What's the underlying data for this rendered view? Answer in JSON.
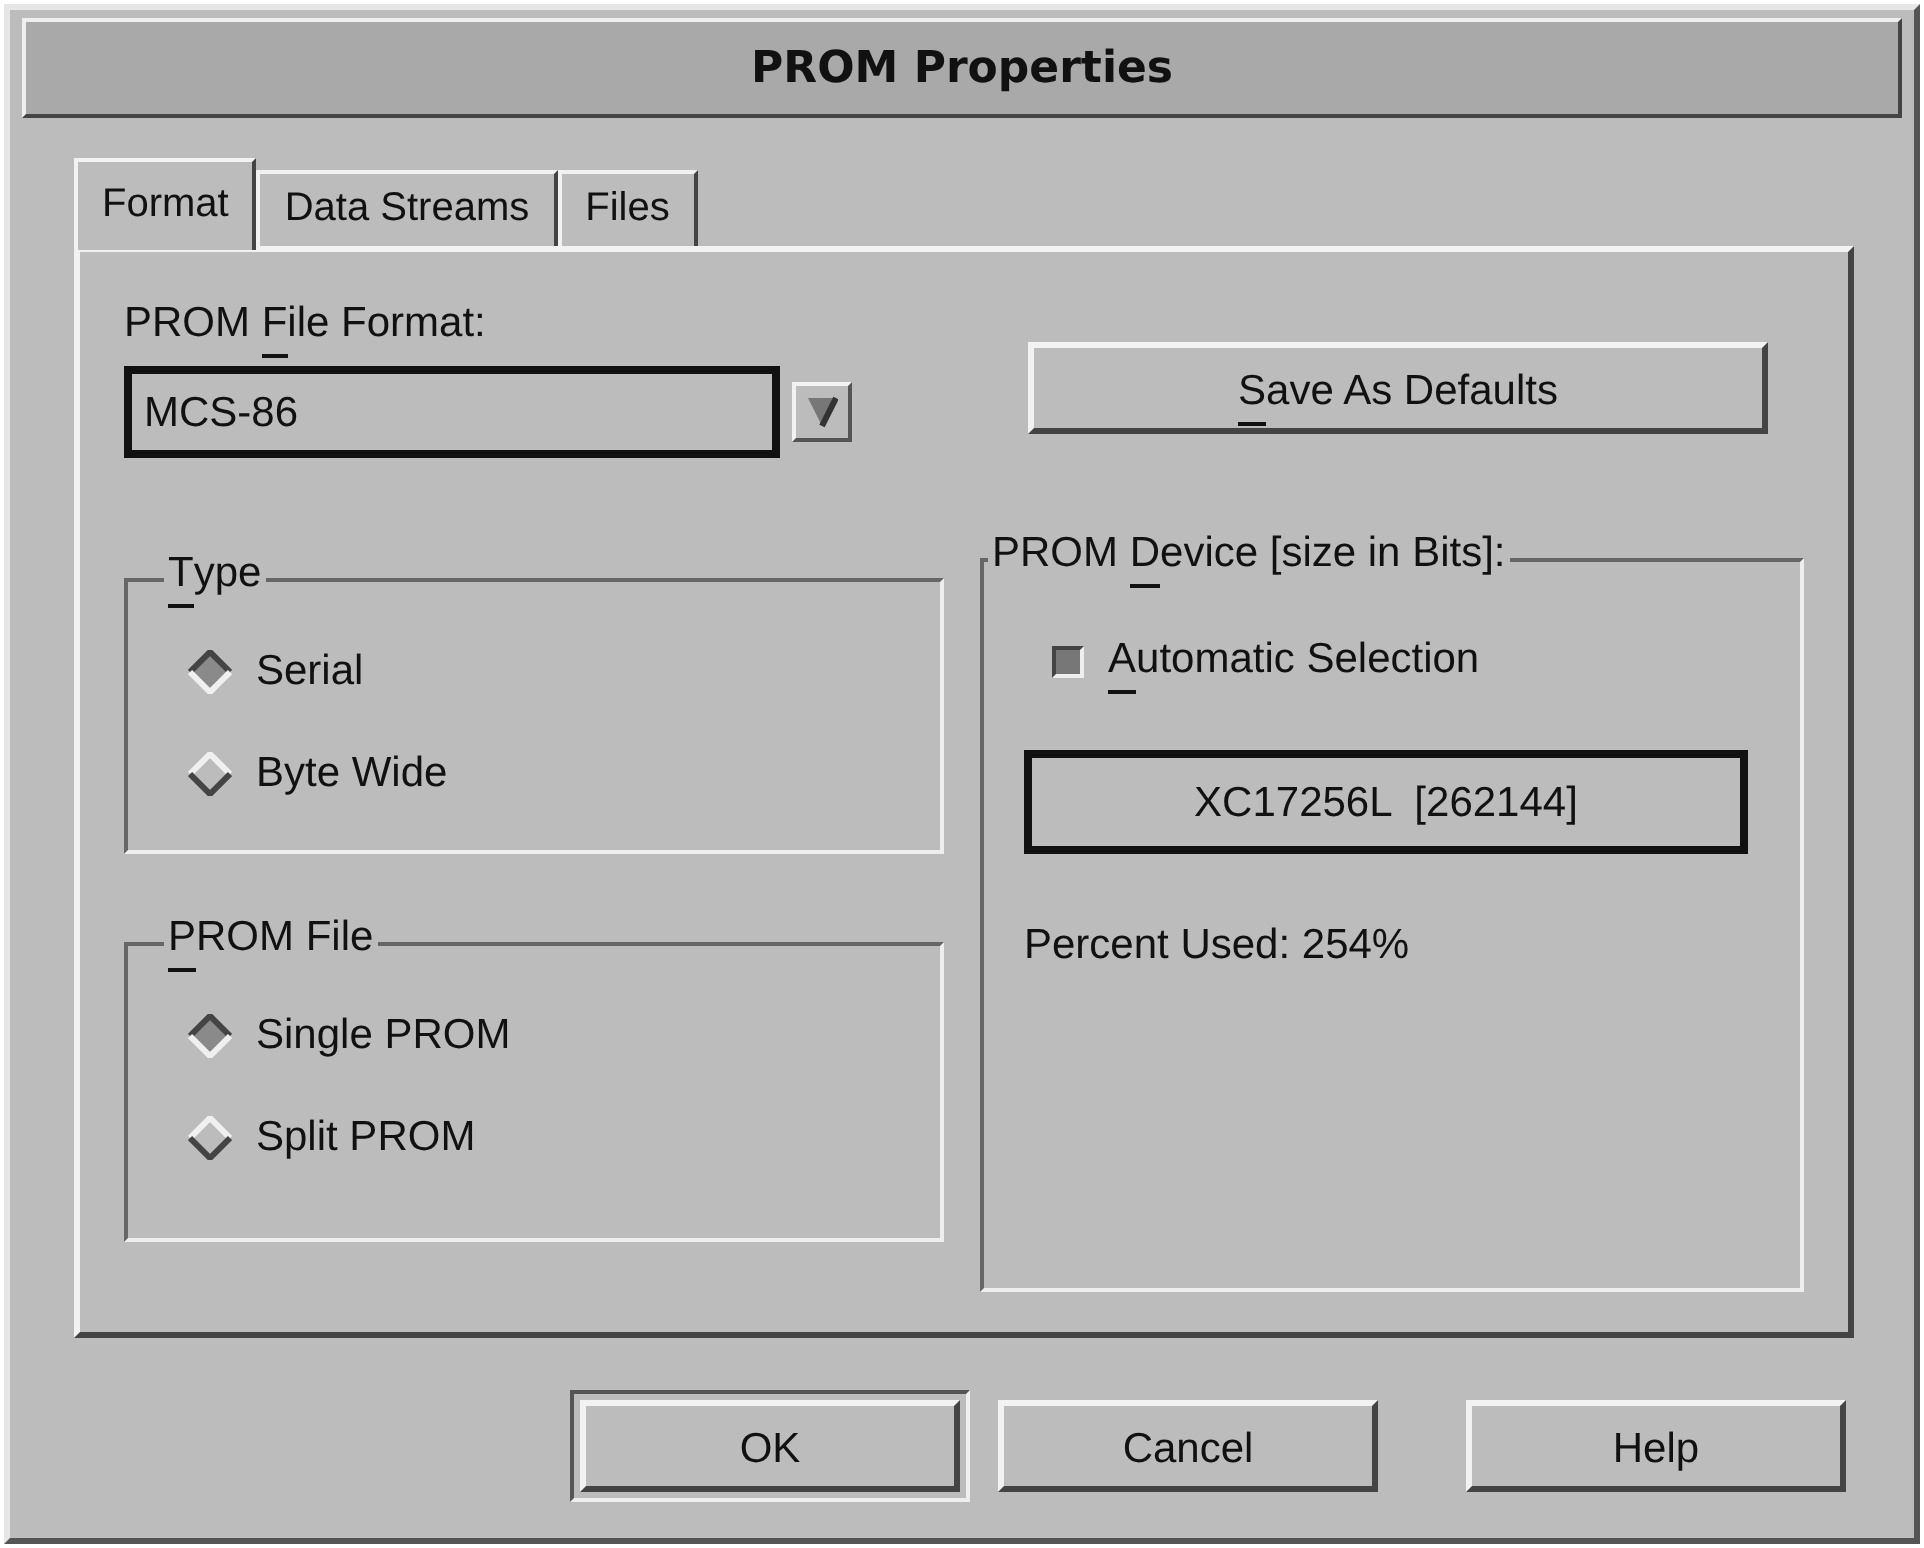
{
  "window": {
    "title": "PROM Properties"
  },
  "tabs": [
    {
      "label": "Format",
      "selected": true
    },
    {
      "label": "Data Streams",
      "selected": false
    },
    {
      "label": "Files",
      "selected": false
    }
  ],
  "file_format": {
    "label": [
      {
        "text": "PROM ",
        "mnemonic": false
      },
      {
        "text": "F",
        "mnemonic": true
      },
      {
        "text": "ile Format:",
        "mnemonic": false
      }
    ],
    "value": "MCS-86"
  },
  "save_defaults_button": {
    "label": [
      {
        "text": "S",
        "mnemonic": true
      },
      {
        "text": "ave As Defaults",
        "mnemonic": false
      }
    ]
  },
  "type_group": {
    "label": [
      {
        "text": "T",
        "mnemonic": true
      },
      {
        "text": "ype",
        "mnemonic": false
      }
    ],
    "options": [
      {
        "label": "Serial",
        "selected": true
      },
      {
        "label": "Byte Wide",
        "selected": false
      }
    ]
  },
  "prom_file_group": {
    "label": [
      {
        "text": "P",
        "mnemonic": true
      },
      {
        "text": "ROM File",
        "mnemonic": false
      }
    ],
    "options": [
      {
        "label": "Single PROM",
        "selected": true
      },
      {
        "label": "Split PROM",
        "selected": false
      }
    ]
  },
  "device_group": {
    "label": [
      {
        "text": "PROM ",
        "mnemonic": false
      },
      {
        "text": "D",
        "mnemonic": true
      },
      {
        "text": "evice [size in Bits]:",
        "mnemonic": false
      }
    ],
    "automatic_selection": {
      "label": [
        {
          "text": "A",
          "mnemonic": true
        },
        {
          "text": "utomatic Selection",
          "mnemonic": false
        }
      ],
      "checked": true
    },
    "device": "XC17256L  [262144]",
    "percent_used": "Percent Used: 254%"
  },
  "buttons": [
    {
      "label": "OK",
      "default": true
    },
    {
      "label": "Cancel",
      "default": false
    },
    {
      "label": "Help",
      "default": false
    }
  ]
}
